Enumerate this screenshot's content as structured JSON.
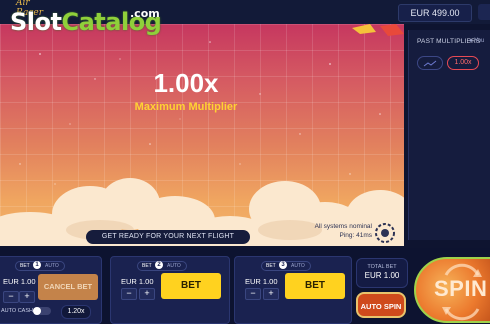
{
  "watermark": {
    "sub": "Air Racer",
    "main_prefix": "Slot",
    "main_accent": "Catalog",
    "domain": ".com"
  },
  "header": {
    "balance": "EUR 499.00",
    "menu_icon": "menu-icon"
  },
  "game": {
    "multiplier": "1.00x",
    "multiplier_label": "Maximum Multiplier",
    "ready_message": "GET READY FOR YOUR NEXT FLIGHT",
    "system_status": "All systems nominal",
    "ping": "Ping: 41ms",
    "colors": {
      "sky_top": "#c6375f",
      "sky_bottom": "#f2b56c",
      "accent": "#ffd233"
    }
  },
  "sidebar": {
    "title": "PAST MULTIPLIERS",
    "you_label": "You",
    "chart_icon": "trend-chart-icon",
    "multipliers": [
      "1.00x"
    ]
  },
  "bet_panels": [
    {
      "tab_bet": "BET",
      "number": "1",
      "tab_auto": "AUTO",
      "amount": "EUR 1.00",
      "minus": "−",
      "plus": "+",
      "action": "CANCEL BET",
      "cashout_label": "AUTO CASH OUT",
      "cashout_value": "1.20x"
    },
    {
      "tab_bet": "BET",
      "number": "2",
      "tab_auto": "AUTO",
      "amount": "EUR 1.00",
      "minus": "−",
      "plus": "+",
      "action": "BET"
    },
    {
      "tab_bet": "BET",
      "number": "3",
      "tab_auto": "AUTO",
      "amount": "EUR 1.00",
      "minus": "−",
      "plus": "+",
      "action": "BET"
    }
  ],
  "controls": {
    "total_bet_label": "TOTAL BET",
    "total_bet_value": "EUR 1.00",
    "auto_spin": "AUTO SPIN",
    "spin": "SPIN",
    "colors": {
      "bet_button": "#ffd21f",
      "spin_button": "#ec7a2e",
      "auto_spin": "#cf4a1c"
    }
  }
}
